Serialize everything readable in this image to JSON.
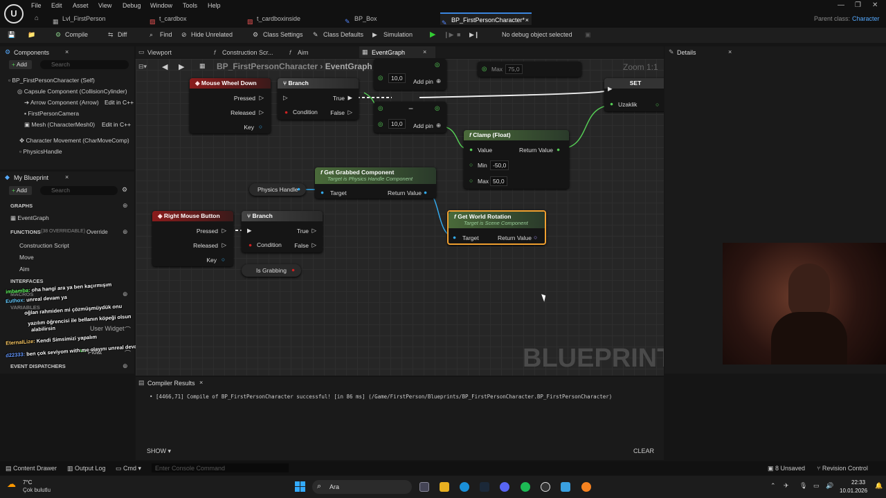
{
  "menu": [
    "File",
    "Edit",
    "Asset",
    "View",
    "Debug",
    "Window",
    "Tools",
    "Help"
  ],
  "tabs": [
    "Lvl_FirstPerson",
    "t_cardbox",
    "t_cardboxinside",
    "BP_Box",
    "BP_FirstPersonCharacter*"
  ],
  "parent_class": {
    "label": "Parent class:",
    "value": "Character"
  },
  "toolbar": {
    "compile": "Compile",
    "diff": "Diff",
    "find": "Find",
    "hide_unrelated": "Hide Unrelated",
    "class_settings": "Class Settings",
    "class_defaults": "Class Defaults",
    "simulation": "Simulation",
    "debug": "No debug object selected"
  },
  "components": {
    "title": "Components",
    "add": "Add",
    "search_placeholder": "Search",
    "items": [
      "BP_FirstPersonCharacter (Self)",
      "Capsule Component (CollisionCylinder)",
      "Arrow Component (Arrow)",
      "FirstPersonCamera",
      "Mesh (CharacterMesh0)",
      "Character Movement (CharMoveComp)",
      "PhysicsHandle"
    ],
    "edit_cpp": "Edit in C++"
  },
  "my_blueprint": {
    "title": "My Blueprint",
    "add": "Add",
    "search_placeholder": "Search",
    "graphs_label": "GRAPHS",
    "graph_item": "EventGraph",
    "functions_label": "FUNCTIONS",
    "functions_count": "(38 OVERRIDABLE)",
    "override": "Override",
    "functions": [
      "Construction Script",
      "Move",
      "Aim"
    ],
    "interfaces_label": "INTERFACES",
    "macros_label": "MACROS",
    "variables_label": "VARIABLES",
    "var_widget": "User Widget",
    "var_float": "Float",
    "dispatchers_label": "EVENT DISPATCHERS"
  },
  "editor_tabs": [
    "Viewport",
    "Construction Scr...",
    "Aim",
    "EventGraph"
  ],
  "breadcrumb": {
    "bp": "BP_FirstPersonCharacter",
    "graph": "EventGraph",
    "zoom": "Zoom 1:1"
  },
  "details": {
    "title": "Details"
  },
  "nodes": {
    "mouse_wheel": {
      "title": "Mouse Wheel Down",
      "pins": [
        "Pressed",
        "Released",
        "Key"
      ]
    },
    "branch1": {
      "title": "Branch",
      "pins": [
        "Condition",
        "True",
        "False"
      ]
    },
    "add1": {
      "v": "10,0",
      "label": "Add pin"
    },
    "add2": {
      "v": "10,0",
      "label": "Add pin"
    },
    "max_top": {
      "label": "Max",
      "v": "75,0"
    },
    "set": {
      "title": "SET",
      "pin": "Uzaklik"
    },
    "clamp": {
      "title": "Clamp (Float)",
      "pins": [
        "Value",
        "Min",
        "Max",
        "Return Value"
      ],
      "min": "-50,0",
      "max": "50,0"
    },
    "grabbed": {
      "title": "Get Grabbed Component",
      "sub": "Target is Physics Handle Component",
      "pins": [
        "Target",
        "Return Value"
      ]
    },
    "physics_handle": "Physics Handle",
    "rmb": {
      "title": "Right Mouse Button",
      "pins": [
        "Pressed",
        "Released",
        "Key"
      ]
    },
    "branch2": {
      "title": "Branch",
      "pins": [
        "Condition",
        "True",
        "False"
      ]
    },
    "grabbing": "Is Grabbing",
    "world_rot": {
      "title": "Get World Rotation",
      "sub": "Target is Scene Component",
      "pins": [
        "Target",
        "Return Value"
      ]
    }
  },
  "watermark": "BLUEPRINT",
  "compiler": {
    "title": "Compiler Results",
    "message": "• [4466,71] Compile of BP_FirstPersonCharacter successful! [in 86 ms] (/Game/FirstPerson/Blueprints/BP_FirstPersonCharacter.BP_FirstPersonCharacter)",
    "show": "SHOW",
    "clear": "CLEAR"
  },
  "chat": [
    {
      "user": "imbamba:",
      "text": "oha hangi ara ya ben kaçırmışım",
      "color": "#6f6"
    },
    {
      "user": "Euthox:",
      "text": "unreal devam ya",
      "color": "#6cf"
    },
    {
      "user": "",
      "text": "oğlan rahmiden mi çözmüşmüydük onu",
      "color": "#f66"
    },
    {
      "user": "",
      "text": "yazılım öğrencisi ile bellanın köpeği olsun",
      "color": "#f80"
    },
    {
      "user": "",
      "text": "alabilirsin",
      "color": "#f6f"
    },
    {
      "user": "EternalLize:",
      "text": "Kendi Simsimizi yapalım",
      "color": "#fc6"
    },
    {
      "user": "d22333:",
      "text": "ben çok seviyom with me olayını unreal devamı sert",
      "color": "#69f"
    }
  ],
  "statusbar": {
    "content_drawer": "Content Drawer",
    "output_log": "Output Log",
    "cmd": "Cmd",
    "console_placeholder": "Enter Console Command",
    "unsaved": "8 Unsaved",
    "revision": "Revision Control"
  },
  "taskbar": {
    "temp": "7°C",
    "weather": "Çok bulutlu",
    "search": "Ara",
    "time": "22:33",
    "date": "10.01.2026"
  }
}
